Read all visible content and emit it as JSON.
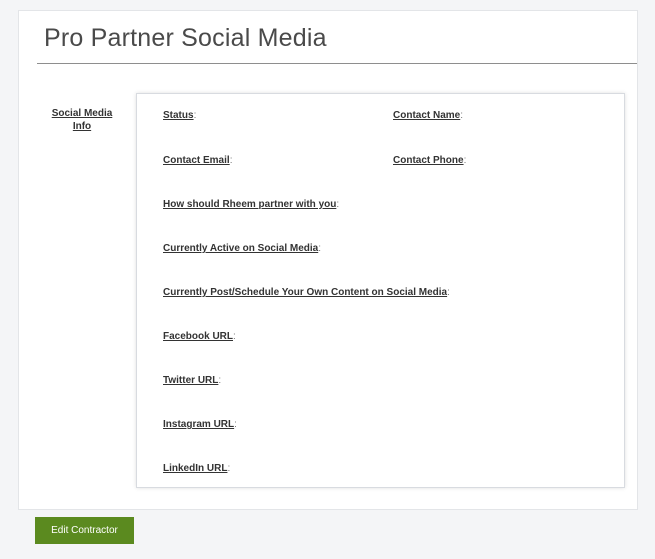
{
  "page": {
    "title": "Pro Partner Social Media"
  },
  "section": {
    "label": "Social Media Info"
  },
  "fields": {
    "status": "Status",
    "contact_name": "Contact Name",
    "contact_email": "Contact Email",
    "contact_phone": "Contact Phone",
    "partner_with_you": "How should Rheem partner with you",
    "active_social": "Currently Active on Social Media",
    "own_content": "Currently Post/Schedule Your Own Content on Social Media",
    "facebook_url": "Facebook URL",
    "twitter_url": "Twitter URL",
    "instagram_url": "Instagram URL",
    "linkedin_url": "LinkedIn URL",
    "separator": ":"
  },
  "actions": {
    "edit_label": "Edit Contractor"
  },
  "colors": {
    "accent": "#5b8a1f"
  }
}
